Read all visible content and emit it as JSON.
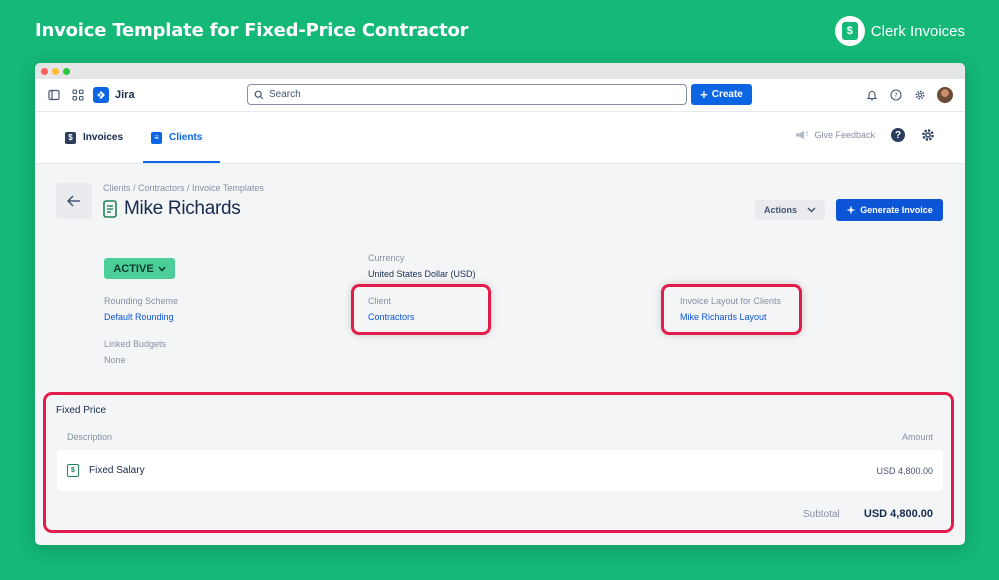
{
  "banner": {
    "title": "Invoice Template for Fixed-Price Contractor",
    "brand_name": "Clerk Invoices",
    "brand_color": "#14b877"
  },
  "topnav": {
    "app_name": "Jira",
    "search_placeholder": "Search",
    "create_label": "Create"
  },
  "subnav": {
    "tabs": [
      {
        "label": "Invoices",
        "icon": "invoice-icon",
        "active": false
      },
      {
        "label": "Clients",
        "icon": "clients-icon",
        "active": true
      }
    ],
    "feedback_label": "Give Feedback"
  },
  "page": {
    "breadcrumb": "Clients  /  Contractors  /  Invoice Templates",
    "title": "Mike Richards",
    "actions_label": "Actions",
    "generate_label": "Generate Invoice",
    "status": "ACTIVE"
  },
  "fields": {
    "currency_label": "Currency",
    "currency_value": "United States Dollar (USD)",
    "rounding_label": "Rounding Scheme",
    "rounding_value": "Default Rounding",
    "client_label": "Client",
    "client_value": "Contractors",
    "layout_label": "Invoice Layout for Clients",
    "layout_value": "Mike Richards Layout",
    "budgets_label": "Linked Budgets",
    "budgets_value": "None"
  },
  "fixed_price": {
    "title": "Fixed Price",
    "col_description": "Description",
    "col_amount": "Amount",
    "items": [
      {
        "name": "Fixed Salary",
        "amount": "USD 4,800.00"
      }
    ],
    "subtotal_label": "Subtotal",
    "subtotal_value": "USD 4,800.00"
  },
  "colors": {
    "accent": "#0c66e4",
    "highlight": "#e21d4a",
    "status": "#4bce97"
  }
}
